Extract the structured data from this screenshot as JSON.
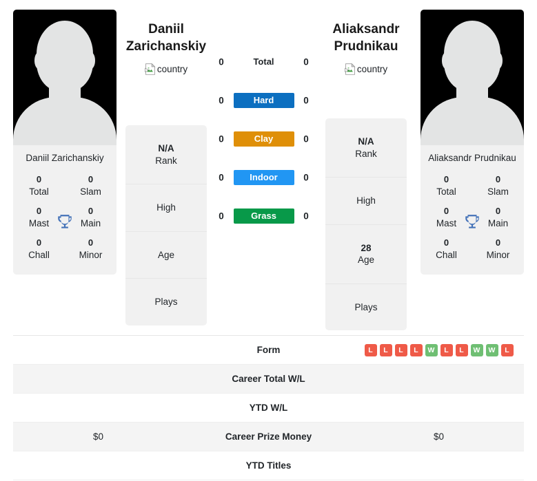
{
  "players": {
    "left": {
      "name": "Daniil Zarichanskiy",
      "name_line1": "Daniil",
      "name_line2": "Zarichanskiy",
      "country_alt": "country",
      "card_name": "Daniil Zarichanskiy",
      "titles": [
        {
          "num": "0",
          "label": "Total"
        },
        {
          "num": "0",
          "label": "Slam"
        },
        {
          "num": "0",
          "label": "Mast"
        },
        {
          "num": "0",
          "label": "Main"
        },
        {
          "num": "0",
          "label": "Chall"
        },
        {
          "num": "0",
          "label": "Minor"
        }
      ],
      "info": [
        {
          "value": "N/A",
          "label": "Rank"
        },
        {
          "value": "",
          "label": "High"
        },
        {
          "value": "",
          "label": "Age"
        },
        {
          "value": "",
          "label": "Plays"
        }
      ]
    },
    "right": {
      "name": "Aliaksandr Prudnikau",
      "name_line1": "Aliaksandr",
      "name_line2": "Prudnikau",
      "country_alt": "country",
      "card_name": "Aliaksandr Prudnikau",
      "titles": [
        {
          "num": "0",
          "label": "Total"
        },
        {
          "num": "0",
          "label": "Slam"
        },
        {
          "num": "0",
          "label": "Mast"
        },
        {
          "num": "0",
          "label": "Main"
        },
        {
          "num": "0",
          "label": "Chall"
        },
        {
          "num": "0",
          "label": "Minor"
        }
      ],
      "info": [
        {
          "value": "N/A",
          "label": "Rank"
        },
        {
          "value": "",
          "label": "High"
        },
        {
          "value": "28",
          "label": "Age"
        },
        {
          "value": "",
          "label": "Plays"
        }
      ]
    }
  },
  "surfaces": [
    {
      "label": "Total",
      "left": "0",
      "right": "0",
      "color": "",
      "plain": true
    },
    {
      "label": "Hard",
      "left": "0",
      "right": "0",
      "color": "#0c6fc0",
      "plain": false
    },
    {
      "label": "Clay",
      "left": "0",
      "right": "0",
      "color": "#df8f08",
      "plain": false
    },
    {
      "label": "Indoor",
      "left": "0",
      "right": "0",
      "color": "#2196f3",
      "plain": false
    },
    {
      "label": "Grass",
      "left": "0",
      "right": "0",
      "color": "#089949",
      "plain": false
    }
  ],
  "stats_rows": [
    {
      "label": "Form",
      "left": "",
      "right": "",
      "type": "form"
    },
    {
      "label": "Career Total W/L",
      "left": "",
      "right": "",
      "type": "text"
    },
    {
      "label": "YTD W/L",
      "left": "",
      "right": "",
      "type": "text"
    },
    {
      "label": "Career Prize Money",
      "left": "$0",
      "right": "$0",
      "type": "text"
    },
    {
      "label": "YTD Titles",
      "left": "",
      "right": "",
      "type": "text"
    }
  ],
  "form": {
    "right_results": [
      "L",
      "L",
      "L",
      "L",
      "W",
      "L",
      "L",
      "W",
      "W",
      "L"
    ],
    "left_results": []
  },
  "colors": {
    "win": "#6fbf73",
    "loss": "#ef5a48",
    "trophy": "#4472b8",
    "card_bg": "#f1f1f1",
    "row_alt_bg": "#f4f4f4"
  },
  "icons": {
    "trophy": "trophy-icon",
    "broken_image": "broken-image-icon"
  }
}
